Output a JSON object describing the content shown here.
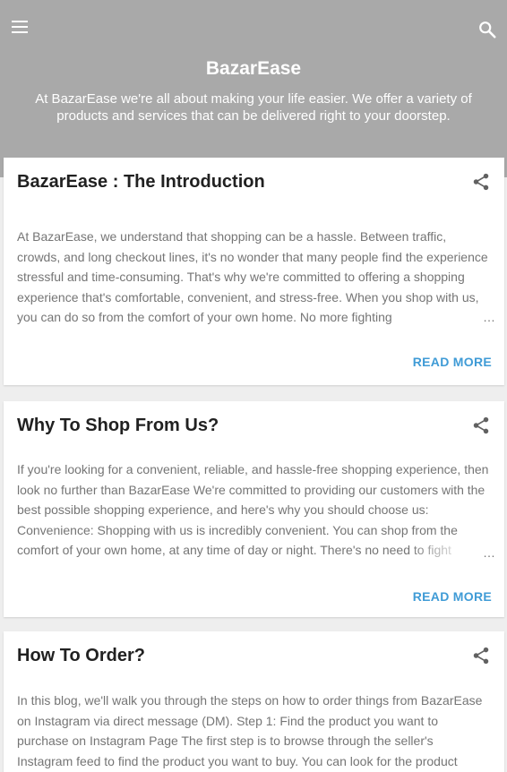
{
  "header": {
    "menu_icon": "hamburger-menu-icon",
    "search_icon": "search-icon",
    "title": "BazarEase",
    "description": "At BazarEase we're all about making your life easier. We offer a variety of products and services that can be delivered right to your doorstep."
  },
  "posts": [
    {
      "title": "BazarEase : The Introduction",
      "share_icon": "share-icon",
      "snippet": "At BazarEase, we understand that shopping can be a hassle. Between traffic, crowds, and long checkout lines, it's no wonder that many people find the experience stressful and time-consuming. That's why we're committed to offering a shopping experience that's comfortable, convenient, and stress-free. When you shop with us, you can do so from the comfort of your own home. No more fighting",
      "ellipsis": "…",
      "read_more": "READ MORE"
    },
    {
      "title": "Why To Shop From Us?",
      "share_icon": "share-icon",
      "snippet": " If you're looking for a convenient, reliable, and hassle-free shopping experience, then look no further than BazarEase We're committed to providing our customers with the best possible shopping experience, and here's why you should choose us: Convenience: Shopping with us is incredibly convenient. You can shop from the comfort of your own home, at any time of day or night. There's no need to fight",
      "ellipsis": "…",
      "read_more": "READ MORE"
    },
    {
      "title": "How To Order?",
      "share_icon": "share-icon",
      "snippet": "In this blog, we'll walk you through the steps on how to order things from BazarEase on Instagram via direct message (DM). Step 1: Find the product you want to purchase on Instagram Page The first step is to browse through the seller's Instagram feed to find the product you want to buy. You can look for the product"
    }
  ],
  "colors": {
    "header_bg": "#a9a9a9",
    "link": "#3f9bd6",
    "title_text": "#212121",
    "body_text": "#757575"
  }
}
